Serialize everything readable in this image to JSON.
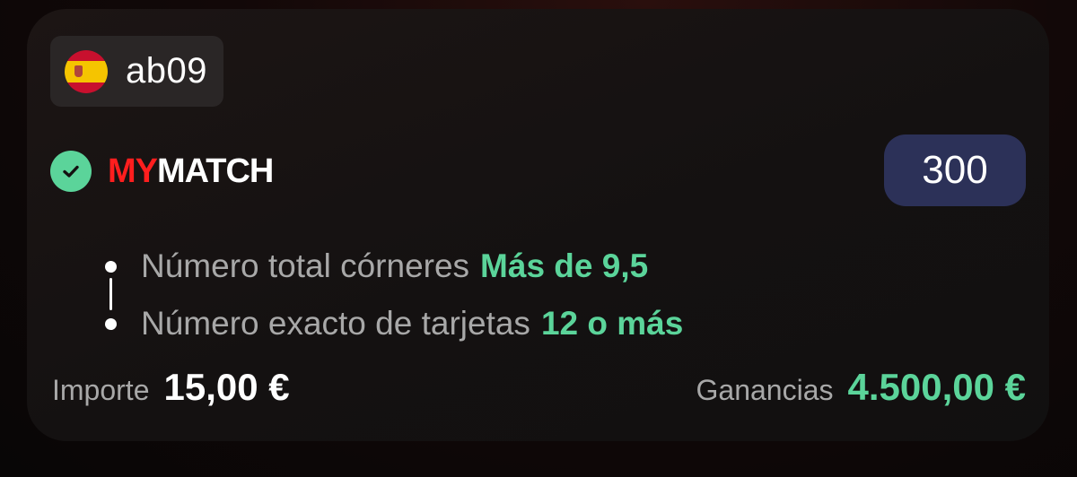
{
  "user": {
    "flag_icon": "spain-flag-icon",
    "name": "ab09"
  },
  "bet": {
    "status_icon": "check-circle-icon",
    "brand_part1": "MY",
    "brand_part2": "MATCH",
    "odds": "300"
  },
  "selections": [
    {
      "market": "Número total córneres",
      "pick": "Más de 9,5"
    },
    {
      "market": "Número exacto de tarjetas",
      "pick": "12 o más"
    }
  ],
  "footer": {
    "stake_label": "Importe",
    "stake_value": "15,00 €",
    "winnings_label": "Ganancias",
    "winnings_value": "4.500,00 €"
  },
  "colors": {
    "accent_green": "#5bd49a",
    "brand_red": "#ff1e1e",
    "odds_bg": "#2c3158"
  }
}
